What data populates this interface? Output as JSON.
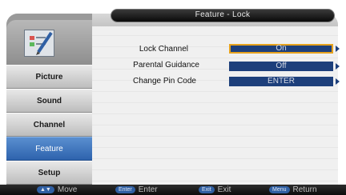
{
  "header": {
    "title": "Feature - Lock"
  },
  "sidebar": {
    "icon": "pencil-checklist-icon",
    "items": [
      {
        "label": "Picture",
        "active": false
      },
      {
        "label": "Sound",
        "active": false
      },
      {
        "label": "Channel",
        "active": false
      },
      {
        "label": "Feature",
        "active": true
      },
      {
        "label": "Setup",
        "active": false
      }
    ]
  },
  "settings": [
    {
      "label": "Lock Channel",
      "value": "On",
      "selected": true
    },
    {
      "label": "Parental Guidance",
      "value": "Off",
      "selected": false
    },
    {
      "label": "Change Pin Code",
      "value": "ENTER",
      "selected": false
    }
  ],
  "footer": {
    "hints": [
      {
        "key": "▲▼",
        "label": "Move"
      },
      {
        "key": "Enter",
        "label": "Enter"
      },
      {
        "key": "Exit",
        "label": "Exit"
      },
      {
        "key": "Menu",
        "label": "Return"
      }
    ]
  },
  "colors": {
    "accent_blue": "#2e63ad",
    "value_box": "#1d3f7b",
    "selection_border": "#e6a21d"
  }
}
